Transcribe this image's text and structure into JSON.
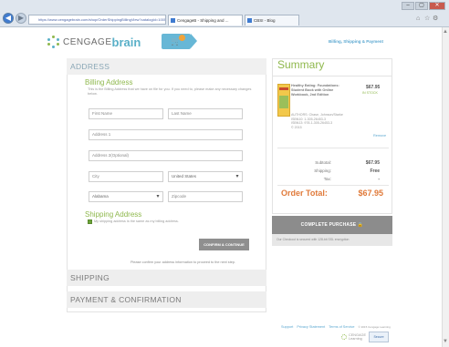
{
  "browser": {
    "url": "https://www.cengagebrain.com/shop/OrderShippingBillingView?catalogId=10057&storeId=...",
    "tabs": [
      {
        "label": "CengageB - Shipping and ..."
      },
      {
        "label": "CBSI - Blog"
      }
    ],
    "window_buttons": [
      "–",
      "▢",
      "✕"
    ]
  },
  "header": {
    "logo_cengage": "CENGAGE",
    "logo_brain": "brain",
    "top_link": "Billing, Shipping & Payment"
  },
  "address": {
    "section_title": "ADDRESS",
    "billing_title": "Billing Address",
    "help_text": "This is the Billing Address that we have on file for you. If you need to, please make any necessary changes below.",
    "fields": {
      "first_name": "First Name",
      "last_name": "Last Name",
      "address1": "Address 1",
      "address2": "Address 2(Optional)",
      "city": "City",
      "country": "United States",
      "state": "Alabama",
      "zip": "Zipcode"
    },
    "shipping_title": "Shipping Address",
    "same_as_billing": "My shipping address is the same as my billing address.",
    "confirm_button": "CONFIRM & CONTINUE",
    "confirm_note": "Please confirm your address information to proceed to the next step."
  },
  "sections": {
    "shipping": "SHIPPING",
    "payment": "PAYMENT & CONFIRMATION"
  },
  "summary": {
    "title": "Summary",
    "item": {
      "title": "Healthy Eating: Foundations: Student Book with Online Workbook, 2nd Edition",
      "meta": "AUTHORS: Chase, Johnson/Starke\nISBN10: 1-305-26453-3\nISBN13: 978-1-305-26453-3\n© 2015",
      "price": "$67.95",
      "stock": "IN STOCK",
      "remove": "Remove"
    },
    "subtotal_label": "Subtotal:",
    "subtotal_value": "$67.95",
    "shipping_label": "Shipping:",
    "shipping_value": "Free",
    "tax_label": "Tax:",
    "tax_value": "-",
    "order_total_label": "Order Total:",
    "order_total_value": "$67.95",
    "complete_button": "COMPLETE PURCHASE 🔒",
    "checkout_note": "Our Checkout is secured with 128-bit SSL encryption"
  },
  "footer": {
    "links": [
      "Support",
      "Privacy Statement",
      "Terms of Service"
    ],
    "copyright": "© 2015 Cengage Learning",
    "logo_line1": "CENGAGE",
    "logo_line2": "Learning",
    "badge": "Secure"
  },
  "colors": {
    "green": "#8fb84d",
    "blue_link": "#5aa7d0",
    "orange_total": "#e07a3a",
    "button_gray": "#8c8c8c"
  }
}
